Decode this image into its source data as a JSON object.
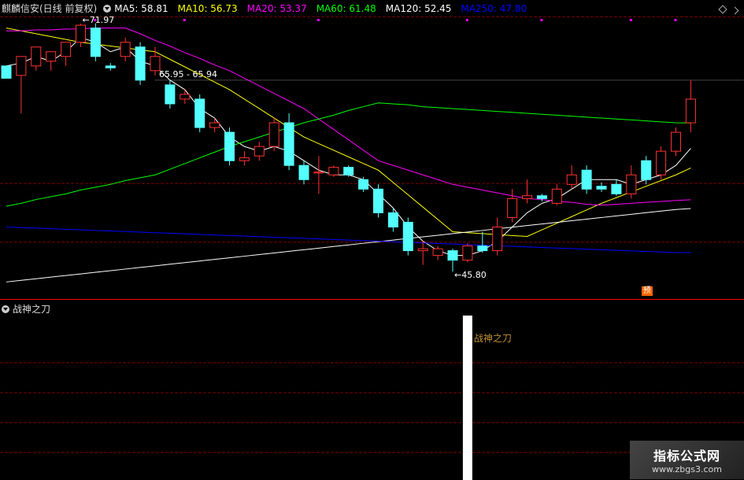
{
  "header": {
    "stock_name": "麒麟信安(日线 前复权)",
    "ma_labels": [
      {
        "text": "MA5: 58.81",
        "color": "#ffffff"
      },
      {
        "text": "MA10: 56.73",
        "color": "#ffff00"
      },
      {
        "text": "MA20: 53.37",
        "color": "#ff00ff"
      },
      {
        "text": "MA60: 61.48",
        "color": "#00ff00"
      },
      {
        "text": "MA120: 52.45",
        "color": "#ffffff"
      },
      {
        "text": "MA250: 47.80",
        "color": "#0000ff"
      }
    ]
  },
  "sub_chart": {
    "title": "战神之刀",
    "signal_label": "战神之刀"
  },
  "watermark": {
    "title": "指标公式网",
    "url": "www.zbgs3.com"
  },
  "annotations": {
    "high_val": "71.97",
    "resistance_val": "65.95 - 65.94",
    "low_val": "45.80",
    "tag_label": "预"
  },
  "chart_data": {
    "type": "candlestick",
    "price_range": [
      42.9,
      74.46
    ],
    "candles": [
      [
        67.5,
        67.5,
        66.2,
        66.2
      ],
      [
        66.5,
        68.5,
        62.5,
        68.5
      ],
      [
        67.5,
        69.5,
        67.0,
        69.5
      ],
      [
        68.0,
        69.0,
        67.0,
        69.0
      ],
      [
        68.5,
        70.0,
        67.5,
        70.0
      ],
      [
        70.0,
        71.97,
        69.5,
        71.8
      ],
      [
        71.5,
        72.0,
        68.0,
        68.5
      ],
      [
        67.5,
        67.8,
        67.0,
        67.3
      ],
      [
        68.5,
        70.5,
        68.0,
        70.0
      ],
      [
        69.5,
        70.0,
        65.5,
        66.0
      ],
      [
        67.0,
        69.5,
        66.5,
        68.5
      ],
      [
        65.5,
        66.0,
        63.0,
        63.5
      ],
      [
        64.0,
        65.0,
        63.5,
        64.5
      ],
      [
        64.0,
        64.5,
        60.5,
        61.0
      ],
      [
        61.0,
        62.0,
        60.5,
        61.5
      ],
      [
        60.5,
        61.0,
        57.0,
        57.5
      ],
      [
        57.5,
        58.5,
        57.0,
        57.8
      ],
      [
        58.0,
        59.5,
        57.5,
        59.0
      ],
      [
        59.0,
        62.0,
        58.5,
        61.5
      ],
      [
        61.5,
        62.5,
        56.5,
        57.0
      ],
      [
        57.0,
        57.5,
        55.0,
        55.5
      ],
      [
        56.2,
        58.0,
        54.0,
        56.3
      ],
      [
        56.0,
        57.0,
        55.8,
        56.8
      ],
      [
        56.8,
        57.0,
        55.8,
        56.0
      ],
      [
        55.5,
        55.8,
        54.2,
        54.5
      ],
      [
        54.5,
        55.0,
        51.5,
        52.0
      ],
      [
        52.0,
        52.5,
        50.0,
        50.5
      ],
      [
        51.0,
        51.5,
        47.5,
        48.0
      ],
      [
        48.0,
        49.0,
        46.5,
        48.2
      ],
      [
        47.5,
        48.5,
        47.0,
        48.2
      ],
      [
        48.0,
        48.2,
        45.8,
        47.0
      ],
      [
        47.0,
        48.8,
        46.8,
        48.5
      ],
      [
        48.5,
        50.0,
        47.8,
        48.0
      ],
      [
        48.0,
        51.5,
        47.5,
        50.5
      ],
      [
        51.5,
        54.5,
        51.0,
        53.5
      ],
      [
        53.5,
        55.5,
        53.0,
        53.8
      ],
      [
        53.8,
        54.0,
        53.2,
        53.5
      ],
      [
        53.0,
        55.0,
        52.8,
        54.5
      ],
      [
        55.0,
        57.0,
        54.5,
        56.0
      ],
      [
        56.5,
        57.0,
        54.0,
        54.5
      ],
      [
        54.8,
        55.2,
        54.2,
        54.5
      ],
      [
        55.0,
        55.5,
        53.8,
        54.0
      ],
      [
        54.0,
        57.0,
        53.5,
        56.0
      ],
      [
        57.5,
        58.0,
        55.0,
        55.5
      ],
      [
        56.0,
        59.0,
        55.5,
        58.5
      ],
      [
        58.5,
        61.0,
        58.0,
        60.5
      ],
      [
        61.5,
        66.0,
        60.5,
        64.0
      ]
    ],
    "ma_lines": [
      {
        "name": "MA5",
        "color": "#ffffff",
        "values": [
          67.5,
          67.8,
          68.5,
          68.0,
          69.0,
          70.5,
          70.0,
          69.0,
          69.5,
          68.0,
          67.5,
          66.0,
          65.0,
          63.0,
          62.0,
          60.0,
          59.0,
          58.5,
          59.0,
          58.5,
          57.5,
          56.5,
          56.0,
          56.0,
          55.5,
          54.0,
          52.5,
          50.5,
          49.0,
          48.0,
          47.5,
          47.5,
          48.0,
          49.0,
          50.5,
          52.0,
          53.0,
          53.5,
          54.5,
          55.5,
          55.5,
          55.5,
          55.0,
          55.5,
          56.0,
          57.0,
          58.81
        ]
      },
      {
        "name": "MA10",
        "color": "#ffff00",
        "values": [
          71.5,
          71.2,
          70.9,
          70.6,
          70.3,
          70.0,
          69.8,
          69.6,
          69.4,
          69.2,
          69.0,
          68.2,
          67.4,
          66.6,
          65.8,
          65.0,
          64.0,
          63.0,
          62.0,
          61.0,
          60.0,
          59.3,
          58.6,
          57.9,
          57.2,
          56.5,
          55.2,
          53.9,
          52.6,
          51.3,
          50.0,
          49.9,
          49.8,
          49.7,
          49.6,
          49.5,
          50.2,
          50.9,
          51.6,
          52.3,
          53.0,
          53.6,
          54.2,
          54.8,
          55.4,
          56.0,
          56.73
        ]
      },
      {
        "name": "MA20",
        "color": "#ff00ff",
        "values": [
          71.2,
          71.2,
          71.3,
          71.3,
          71.4,
          71.4,
          71.5,
          71.5,
          71.5,
          70.9,
          70.2,
          69.6,
          68.9,
          68.3,
          67.6,
          67.0,
          66.2,
          65.4,
          64.6,
          63.8,
          63.0,
          61.9,
          60.8,
          59.7,
          58.6,
          57.5,
          57.0,
          56.5,
          56.0,
          55.5,
          55.0,
          54.7,
          54.4,
          54.1,
          53.8,
          53.5,
          53.4,
          53.2,
          53.1,
          52.9,
          52.8,
          52.9,
          53.0,
          53.1,
          53.2,
          53.3,
          53.37
        ]
      },
      {
        "name": "MA60",
        "color": "#00ff00",
        "values": [
          52.7,
          53.0,
          53.4,
          53.7,
          54.0,
          54.4,
          54.7,
          55.0,
          55.4,
          55.7,
          56.0,
          56.6,
          57.2,
          57.8,
          58.4,
          59.0,
          59.5,
          60.0,
          60.5,
          61.0,
          61.5,
          61.9,
          62.3,
          62.8,
          63.2,
          63.6,
          63.5,
          63.4,
          63.2,
          63.1,
          63.0,
          62.9,
          62.8,
          62.7,
          62.6,
          62.5,
          62.4,
          62.3,
          62.2,
          62.1,
          62.0,
          61.9,
          61.8,
          61.7,
          61.6,
          61.5,
          61.48
        ]
      },
      {
        "name": "MA120",
        "color": "#ffffff",
        "values": [
          44.7,
          44.87,
          45.04,
          45.21,
          45.38,
          45.55,
          45.72,
          45.89,
          46.06,
          46.23,
          46.4,
          46.57,
          46.74,
          46.91,
          47.08,
          47.25,
          47.42,
          47.59,
          47.76,
          47.93,
          48.1,
          48.27,
          48.44,
          48.61,
          48.78,
          48.95,
          49.12,
          49.29,
          49.46,
          49.63,
          49.8,
          49.97,
          50.14,
          50.31,
          50.48,
          50.65,
          50.82,
          50.99,
          51.16,
          51.33,
          51.5,
          51.67,
          51.84,
          52.01,
          52.18,
          52.35,
          52.45
        ]
      },
      {
        "name": "MA250",
        "color": "#0000ff",
        "values": [
          50.5,
          50.44,
          50.38,
          50.32,
          50.26,
          50.2,
          50.14,
          50.08,
          50.02,
          49.96,
          49.9,
          49.84,
          49.78,
          49.72,
          49.66,
          49.6,
          49.54,
          49.48,
          49.42,
          49.36,
          49.3,
          49.24,
          49.18,
          49.12,
          49.06,
          49.0,
          48.94,
          48.88,
          48.82,
          48.76,
          48.7,
          48.64,
          48.58,
          48.52,
          48.46,
          48.4,
          48.34,
          48.28,
          48.22,
          48.16,
          48.1,
          48.04,
          47.98,
          47.92,
          47.86,
          47.8,
          47.8
        ]
      }
    ],
    "signals": [
      6,
      12,
      21,
      31,
      36,
      42,
      45
    ],
    "sub_chart_signal_index": 31,
    "annotation_indices": {
      "high": 5,
      "low": 30,
      "tag": 43
    },
    "grid_prices": [
      72.7,
      55.1,
      48.9
    ],
    "resistance_price": 66.0
  }
}
